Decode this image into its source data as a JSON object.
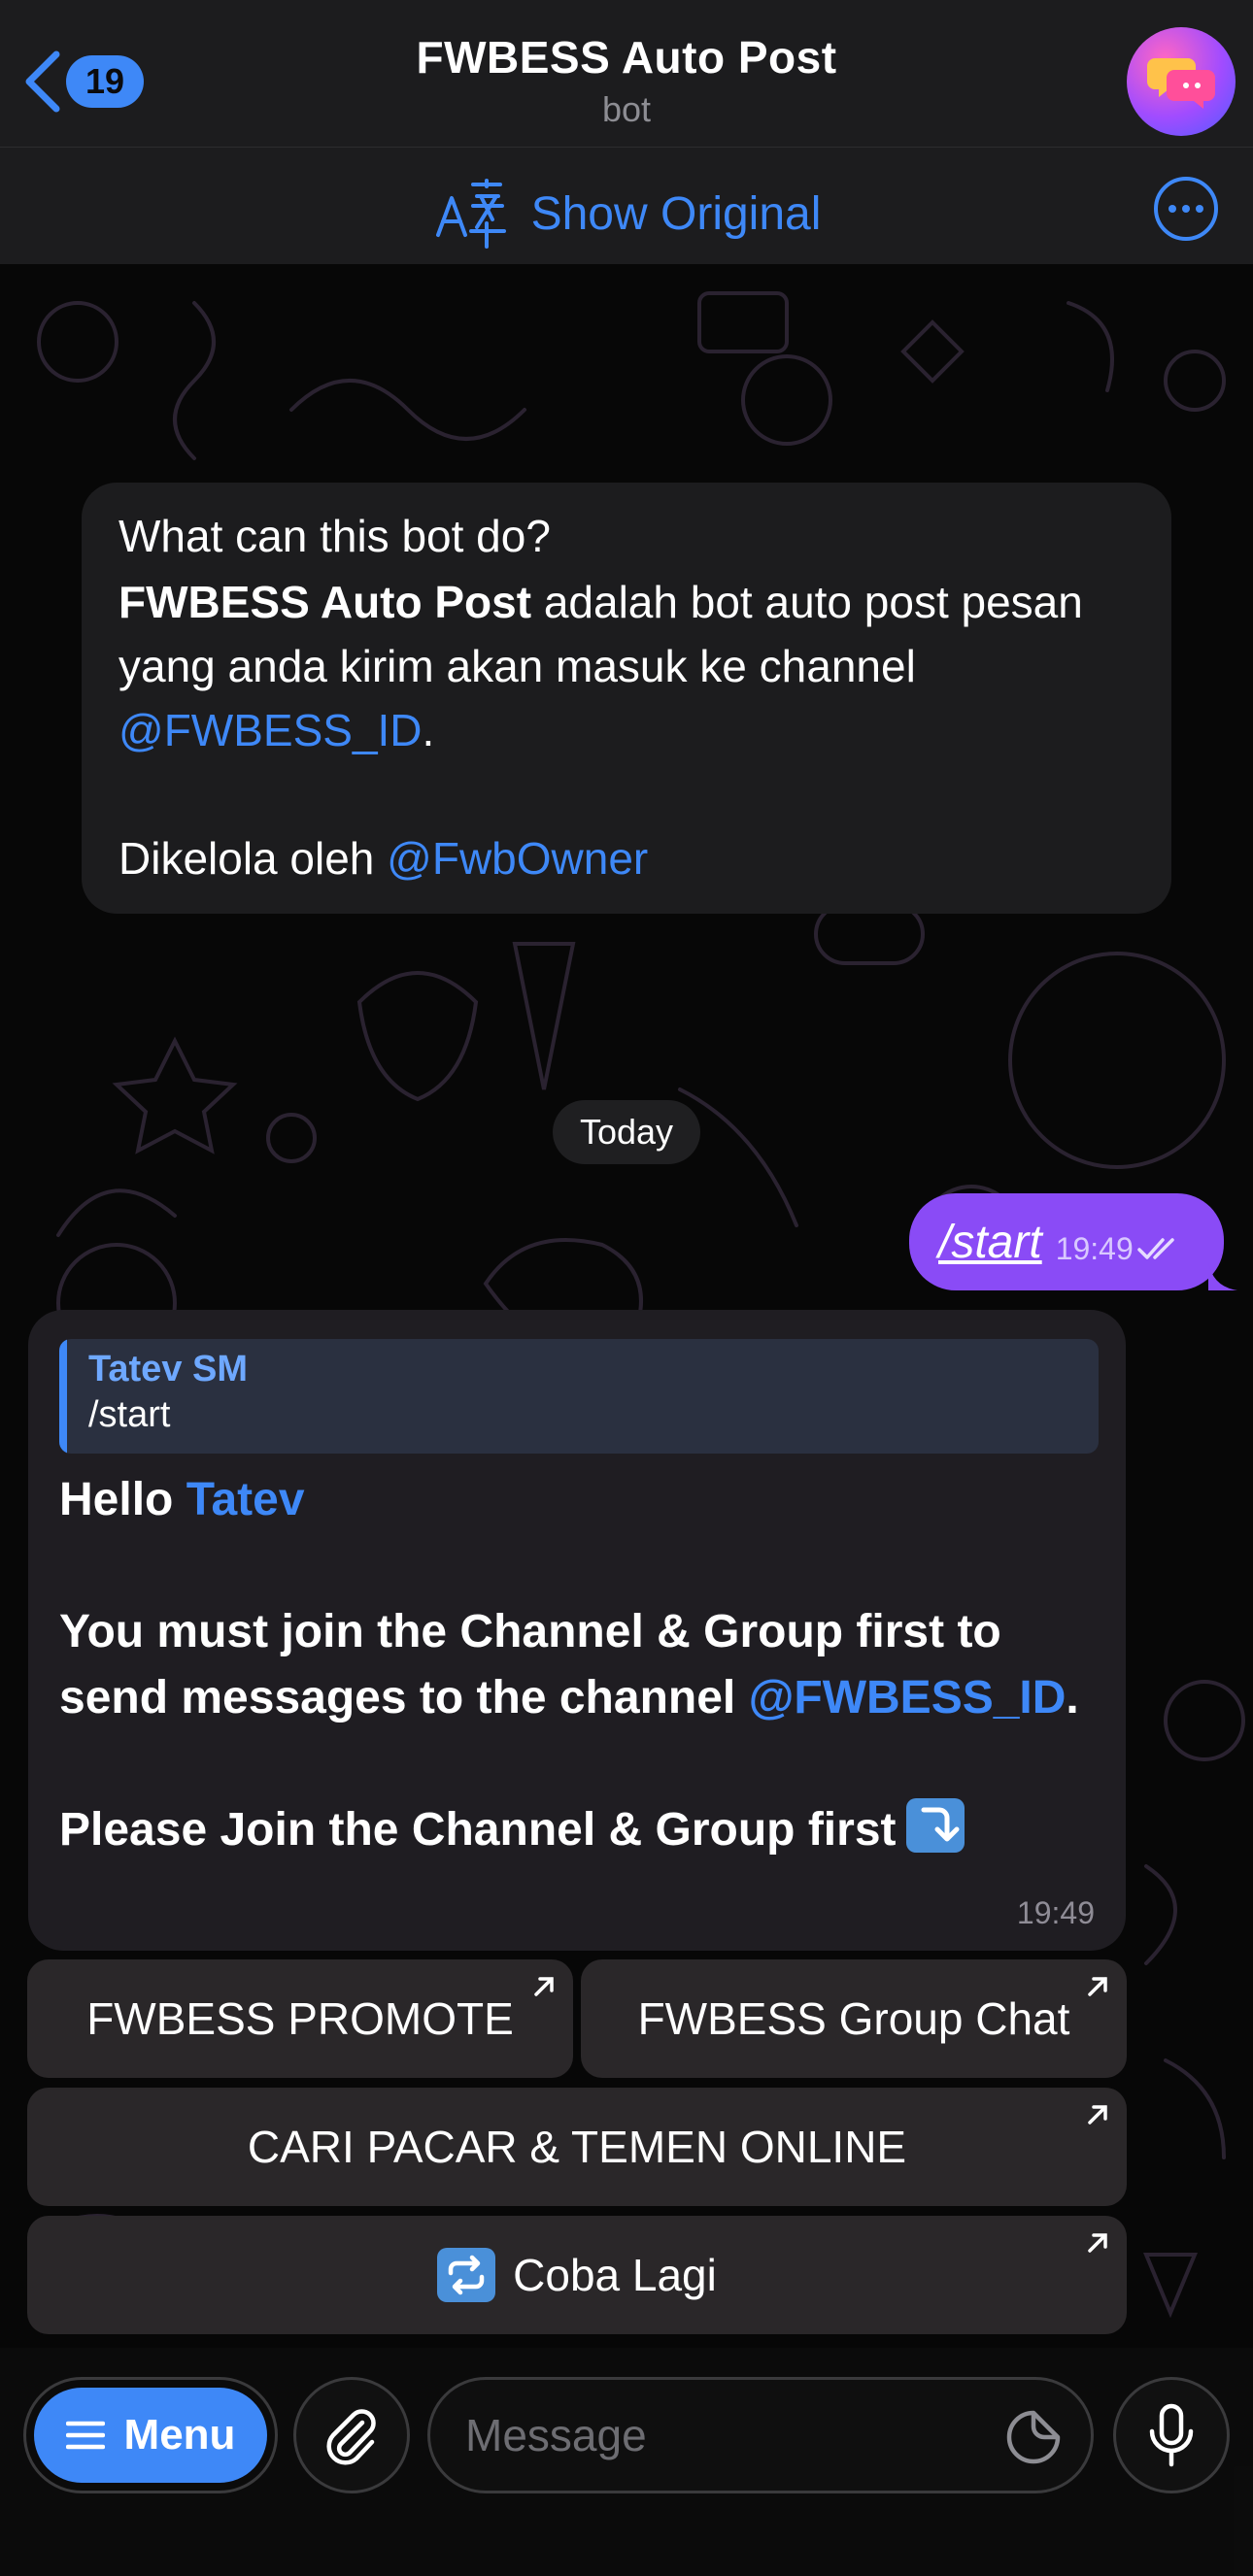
{
  "header": {
    "back_count": "19",
    "title": "FWBESS Auto Post",
    "subtitle": "bot"
  },
  "translate_bar": {
    "label": "Show Original"
  },
  "bot_info": {
    "title": "What can this bot do?",
    "bold_name": "FWBESS Auto Post",
    "text_1": " adalah bot auto post pesan yang anda kirim akan masuk ke channel ",
    "channel_link": "@FWBESS_ID",
    "text_2": ".",
    "managed_by": "Dikelola oleh ",
    "owner_link": "@FwbOwner"
  },
  "date_pill": "Today",
  "outgoing": {
    "text": "/start",
    "time": "19:49"
  },
  "incoming": {
    "reply_name": "Tatev SM",
    "reply_text": "/start",
    "hello": "Hello ",
    "user_link": "Tatev",
    "line_1": "You must join the Channel & Group first to send messages to the channel ",
    "channel_link": "@FWBESS_ID",
    "period": ".",
    "line_2": "Please Join the Channel & Group first",
    "time": "19:49"
  },
  "keyboard": {
    "btn_promote": "FWBESS PROMOTE",
    "btn_group": "FWBESS Group Chat",
    "btn_cari": "CARI PACAR & TEMEN ONLINE",
    "btn_retry": "Coba Lagi"
  },
  "input_bar": {
    "menu_label": "Menu",
    "placeholder": "Message"
  },
  "colors": {
    "accent": "#3e88f7",
    "outgoing_bubble": "#8a4bf6",
    "incoming_bubble": "#1f1d22"
  }
}
